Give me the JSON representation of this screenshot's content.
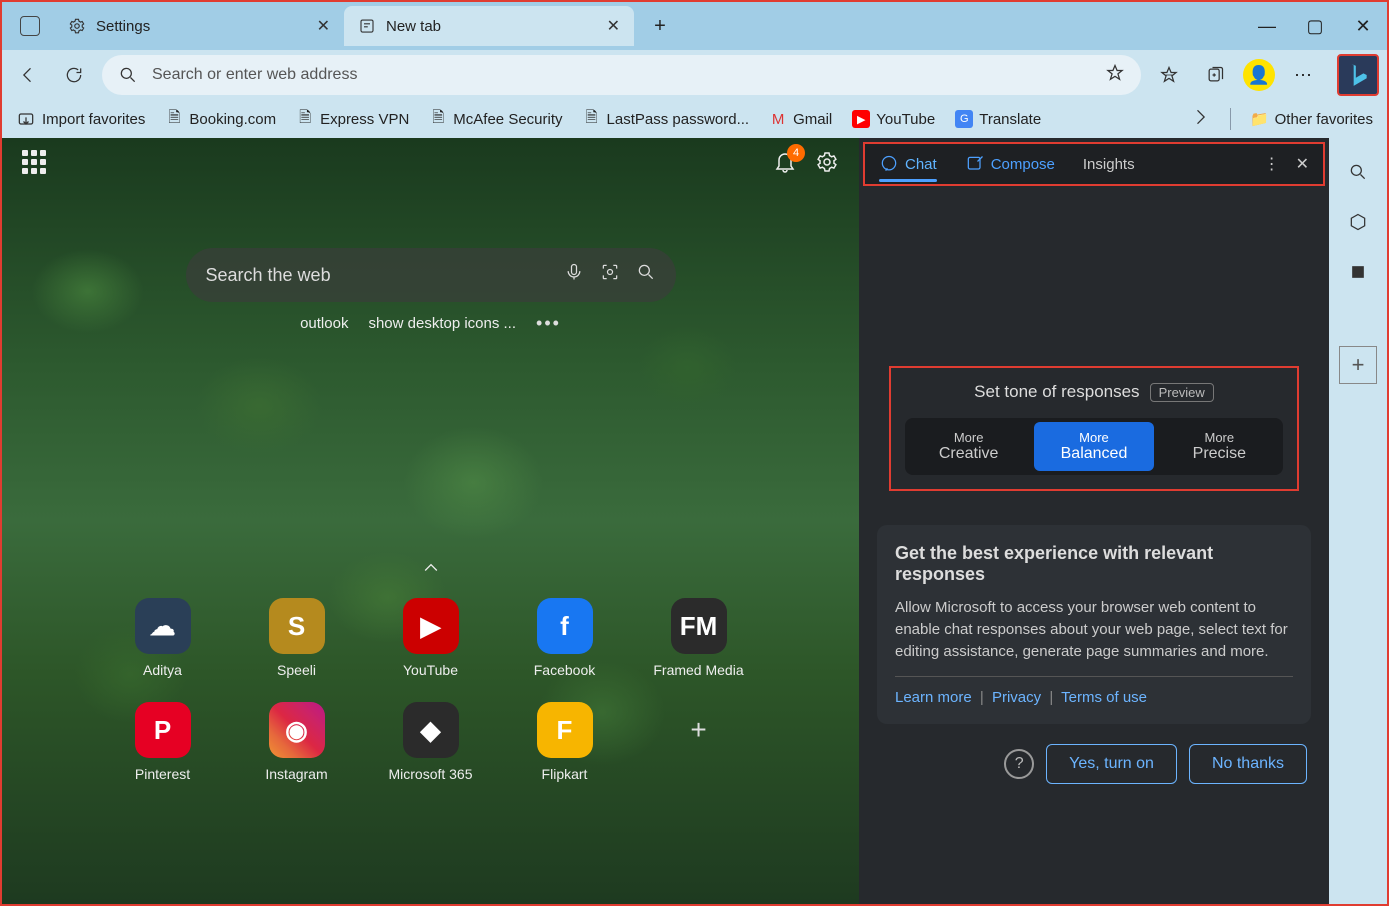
{
  "tabs": [
    {
      "label": "Settings"
    },
    {
      "label": "New tab"
    }
  ],
  "address_bar": {
    "placeholder": "Search or enter web address"
  },
  "toolbar": {
    "import_label": "Import favorites",
    "favorites": [
      "Booking.com",
      "Express VPN",
      "McAfee Security",
      "LastPass password...",
      "Gmail",
      "YouTube",
      "Translate"
    ],
    "other_favorites": "Other favorites"
  },
  "ntp": {
    "search_placeholder": "Search the web",
    "chips": [
      "outlook",
      "show desktop icons ..."
    ],
    "badge": "4",
    "sites_row1": [
      {
        "label": "Aditya",
        "glyph": "☁",
        "bg": "#2a3f57"
      },
      {
        "label": "Speeli",
        "glyph": "S",
        "bg": "#b58a1e"
      },
      {
        "label": "YouTube",
        "glyph": "▶",
        "bg": "#cc0000"
      },
      {
        "label": "Facebook",
        "glyph": "f",
        "bg": "#1877f2"
      },
      {
        "label": "Framed Media",
        "glyph": "FM",
        "bg": "#2b2b2b"
      }
    ],
    "sites_row2": [
      {
        "label": "Pinterest",
        "glyph": "P",
        "bg": "#e60023"
      },
      {
        "label": "Instagram",
        "glyph": "◉",
        "bg": "linear-gradient(45deg,#f09433,#e6683c,#dc2743,#cc2366,#bc1888)"
      },
      {
        "label": "Microsoft 365",
        "glyph": "◆",
        "bg": "#2b2b2b"
      },
      {
        "label": "Flipkart",
        "glyph": "F",
        "bg": "#f7b500"
      }
    ]
  },
  "sidebar": {
    "tabs": [
      "Chat",
      "Compose"
    ],
    "insights": "Insights",
    "tone_title": "Set tone of responses",
    "preview": "Preview",
    "tones": [
      {
        "l1": "More",
        "l2": "Creative"
      },
      {
        "l1": "More",
        "l2": "Balanced"
      },
      {
        "l1": "More",
        "l2": "Precise"
      }
    ],
    "exp_title": "Get the best experience with relevant responses",
    "exp_body": "Allow Microsoft to access your browser web content to enable chat responses about your web page, select text for editing assistance, generate page summaries and more.",
    "learn_more": "Learn more",
    "privacy": "Privacy",
    "terms": "Terms of use",
    "yes": "Yes, turn on",
    "no": "No thanks"
  }
}
